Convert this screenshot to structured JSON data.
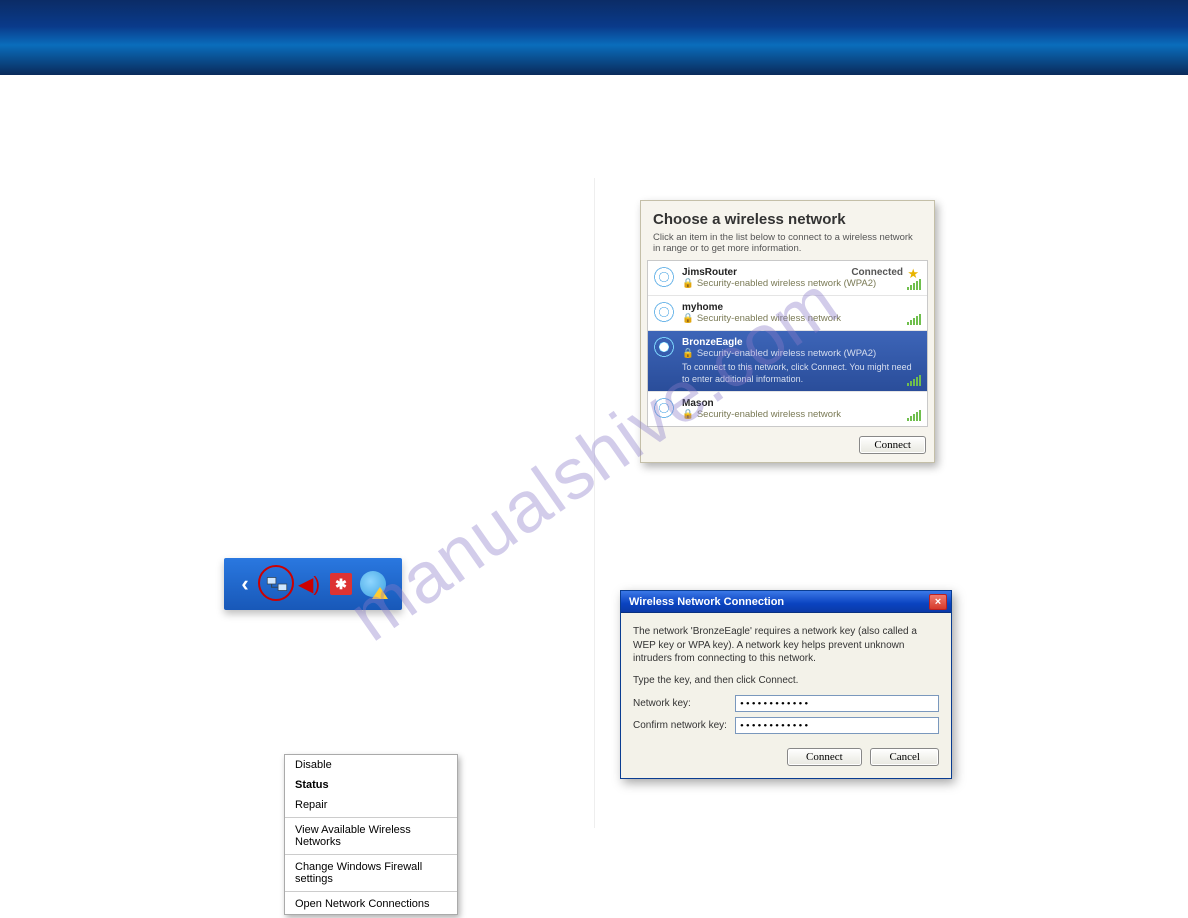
{
  "watermark": "manualshive.com",
  "contextMenu": {
    "disable": "Disable",
    "status": "Status",
    "repair": "Repair",
    "viewNetworks": "View Available Wireless Networks",
    "firewall": "Change Windows Firewall settings",
    "openConnections": "Open Network Connections"
  },
  "networkPanel": {
    "title": "Choose a wireless network",
    "subtitle": "Click an item in the list below to connect to a wireless network in range or to get more information.",
    "items": [
      {
        "name": "JimsRouter",
        "security": "Security-enabled wireless network (WPA2)",
        "status": "Connected"
      },
      {
        "name": "myhome",
        "security": "Security-enabled wireless network"
      },
      {
        "name": "BronzeEagle",
        "security": "Security-enabled wireless network (WPA2)",
        "extra": "To connect to this network, click Connect. You might need to enter additional information."
      },
      {
        "name": "Mason",
        "security": "Security-enabled wireless network"
      }
    ],
    "connect": "Connect"
  },
  "wepDialog": {
    "title": "Wireless Network Connection",
    "body1": "The network 'BronzeEagle' requires a network key (also called a WEP key or WPA key). A network key helps prevent unknown intruders from connecting to this network.",
    "body2": "Type the key, and then click Connect.",
    "labelKey": "Network key:",
    "labelConfirm": "Confirm network key:",
    "value": "••••••••••••",
    "connect": "Connect",
    "cancel": "Cancel"
  }
}
